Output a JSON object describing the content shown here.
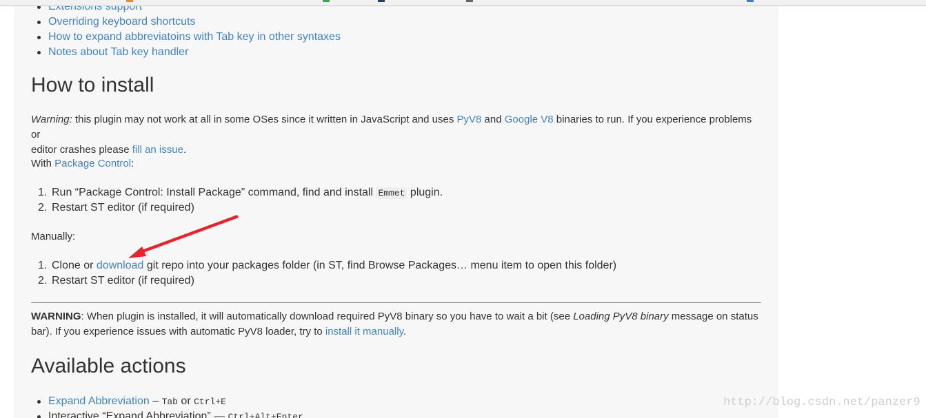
{
  "toc": {
    "items": [
      "Extensions support",
      "Overriding keyboard shortcuts",
      "How to expand abbreviatoins with Tab key in other syntaxes",
      "Notes about Tab key handler"
    ]
  },
  "install": {
    "heading": "How to install",
    "warning_label": "Warning:",
    "warning_text_1": " this plugin may not work at all in some OSes since it written in JavaScript and uses ",
    "link_pyv8": "PyV8",
    "and": " and ",
    "link_googlev8": "Google V8",
    "warning_text_2": " binaries to run. If you experience problems or",
    "warning_text_3": "editor crashes please ",
    "link_issue": "fill an issue",
    "period": ".",
    "with_text": "With ",
    "link_package_control": "Package Control",
    "colon": ":",
    "pc_steps": {
      "s1_num": "1.",
      "s1_pre": "Run “Package Control: Install Package” command, find and install ",
      "s1_code": "Emmet",
      "s1_post": " plugin.",
      "s2_num": "2.",
      "s2": "Restart ST editor (if required)"
    },
    "manually": "Manually:",
    "manual_steps": {
      "s1_num": "1.",
      "s1_pre": "Clone or ",
      "s1_link": "download",
      "s1_post": " git repo into your packages folder (in ST, find Browse Packages… menu item to open this folder)",
      "s2_num": "2.",
      "s2": "Restart ST editor (if required)"
    },
    "note_label": "WARNING",
    "note_1": ": When plugin is installed, it will automatically download required PyV8 binary so you have to wait a bit (see ",
    "note_em": "Loading PyV8 binary",
    "note_2": " message on status",
    "note_3": "bar). If you experience issues with automatic PyV8 loader, try to ",
    "note_link": "install it manually",
    "note_end": "."
  },
  "actions": {
    "heading": "Available actions",
    "item1_link": "Expand Abbreviation",
    "item1_dash": " – ",
    "item1_k1": "Tab",
    "item1_or": " or ",
    "item1_k2": "Ctrl+E",
    "item2_text": "Interactive “Expand Abbreviation” — ",
    "item2_k": "Ctrl+Alt+Enter"
  },
  "watermark": "http://blog.csdn.net/panzer9",
  "colors": {
    "link": "#4183c4",
    "text": "#333333",
    "page_bg": "#f7f7f7",
    "arrow": "#e8232b"
  }
}
